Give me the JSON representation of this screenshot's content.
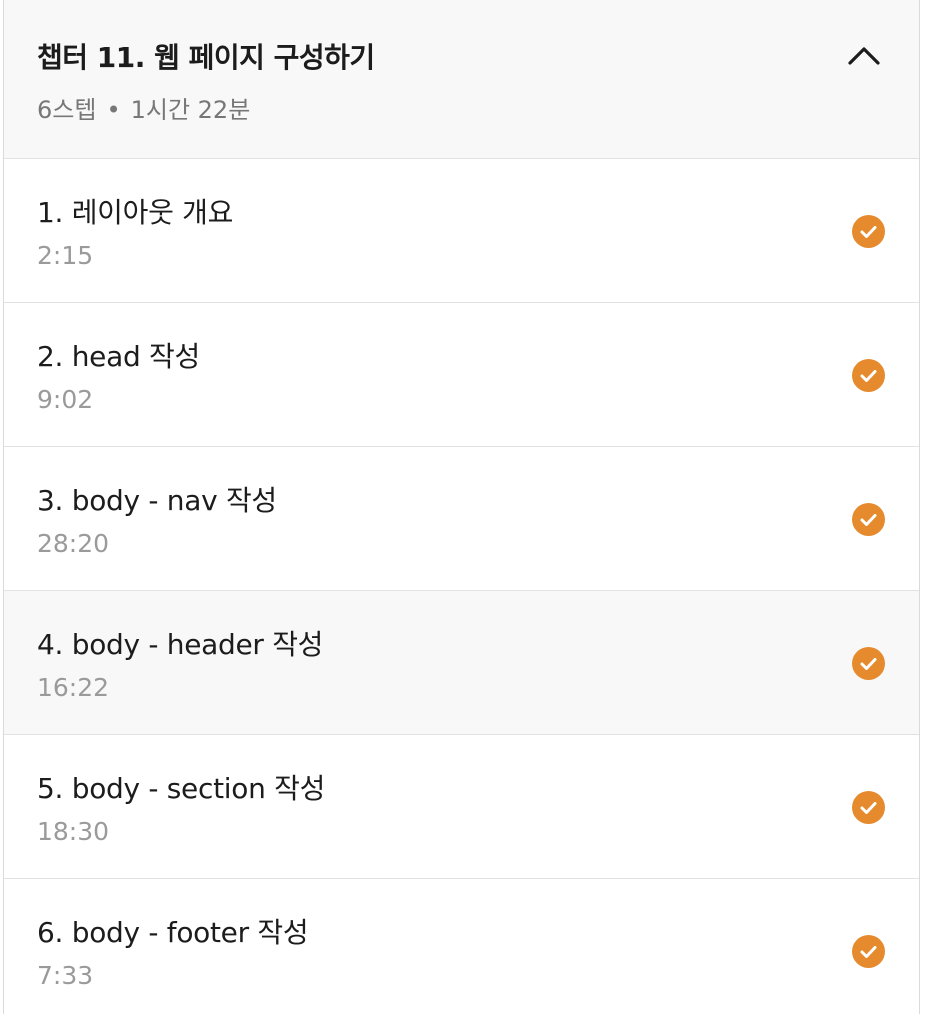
{
  "chapter": {
    "title": "챕터 11. 웹 페이지 구성하기",
    "steps": "6스텝",
    "separator": "•",
    "duration": "1시간 22분"
  },
  "colors": {
    "accent": "#e58a2d",
    "header_bg": "#f8f8f8",
    "border": "#e2e2e2"
  },
  "lessons": [
    {
      "title": "1. 레이아웃 개요",
      "duration": "2:15",
      "completed": true
    },
    {
      "title": "2. head 작성",
      "duration": "9:02",
      "completed": true
    },
    {
      "title": "3. body - nav 작성",
      "duration": "28:20",
      "completed": true
    },
    {
      "title": "4. body - header 작성",
      "duration": "16:22",
      "completed": true
    },
    {
      "title": "5. body - section 작성",
      "duration": "18:30",
      "completed": true
    },
    {
      "title": "6. body - footer 작성",
      "duration": "7:33",
      "completed": true
    }
  ]
}
